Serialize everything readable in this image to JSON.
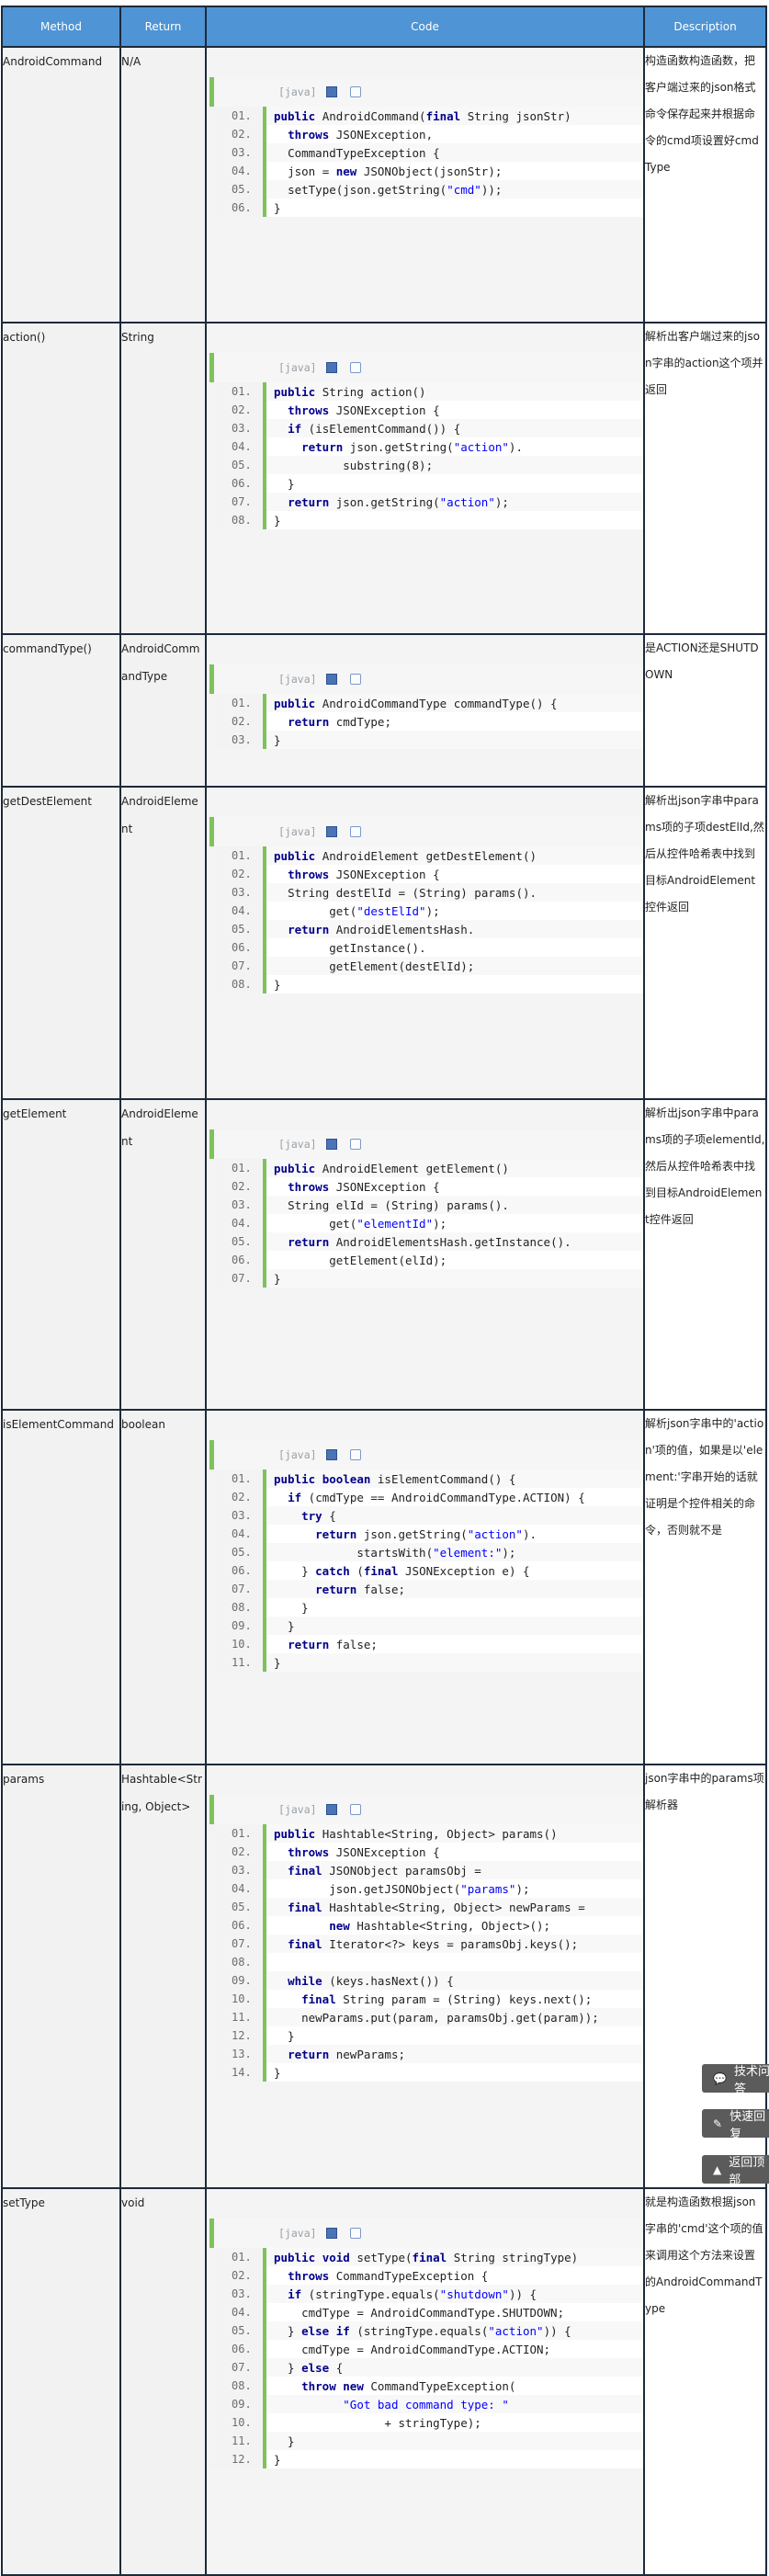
{
  "header": {
    "method": "Method",
    "return": "Return",
    "code": "Code",
    "description": "Description"
  },
  "code_lang_label": "[java]",
  "rows": [
    {
      "method": "AndroidCommand",
      "return": "N/A",
      "desc": "构造函数构造函数，把客户端过来的json格式命令保存起来并根据命令的cmd项设置好cmdType",
      "code": [
        "public AndroidCommand(final String jsonStr)",
        "  throws JSONException,",
        "  CommandTypeException {",
        "  json = new JSONObject(jsonStr);",
        "  setType(json.getString(\"cmd\"));",
        "}"
      ]
    },
    {
      "method": "action()",
      "return": "String",
      "desc": "解析出客户端过来的json字串的action这个项并返回",
      "code": [
        "public String action()",
        "  throws JSONException {",
        "  if (isElementCommand()) {",
        "    return json.getString(\"action\").",
        "          substring(8);",
        "  }",
        "  return json.getString(\"action\");",
        "}"
      ]
    },
    {
      "method": "commandType()",
      "return": "AndroidCommandType",
      "desc": "是ACTION还是SHUTDOWN",
      "code": [
        "public AndroidCommandType commandType() {",
        "  return cmdType;",
        "}"
      ]
    },
    {
      "method": "getDestElement",
      "return": "AndroidElement",
      "desc": "解析出json字串中params项的子项destElId,然后从控件哈希表中找到目标AndroidElement控件返回",
      "code": [
        "public AndroidElement getDestElement()",
        "  throws JSONException {",
        "  String destElId = (String) params().",
        "        get(\"destElId\");",
        "  return AndroidElementsHash.",
        "        getInstance().",
        "        getElement(destElId);",
        "}"
      ]
    },
    {
      "method": "getElement",
      "return": "AndroidElement",
      "desc": "解析出json字串中params项的子项elementId,然后从控件哈希表中找到目标AndroidElement控件返回",
      "code": [
        "public AndroidElement getElement()",
        "  throws JSONException {",
        "  String elId = (String) params().",
        "        get(\"elementId\");",
        "  return AndroidElementsHash.getInstance().",
        "        getElement(elId);",
        "}"
      ]
    },
    {
      "method": "isElementCommand",
      "return": "boolean",
      "desc": "解析json字串中的'action'项的值，如果是以'element:'字串开始的话就证明是个控件相关的命令，否则就不是",
      "code": [
        "public boolean isElementCommand() {",
        "  if (cmdType == AndroidCommandType.ACTION) {",
        "    try {",
        "      return json.getString(\"action\").",
        "            startsWith(\"element:\");",
        "    } catch (final JSONException e) {",
        "      return false;",
        "    }",
        "  }",
        "  return false;",
        "}"
      ]
    },
    {
      "method": "params",
      "return": "Hashtable<String, Object>",
      "desc": "json字串中的params项解析器",
      "code": [
        "public Hashtable<String, Object> params()",
        "  throws JSONException {",
        "  final JSONObject paramsObj =",
        "        json.getJSONObject(\"params\");",
        "  final Hashtable<String, Object> newParams =",
        "        new Hashtable<String, Object>();",
        "  final Iterator<?> keys = paramsObj.keys();",
        "",
        "  while (keys.hasNext()) {",
        "    final String param = (String) keys.next();",
        "    newParams.put(param, paramsObj.get(param));",
        "  }",
        "  return newParams;",
        "}"
      ]
    },
    {
      "method": "setType",
      "return": "void",
      "desc": "就是构造函数根据json字串的'cmd'这个项的值来调用这个方法来设置的AndroidCommandType",
      "code": [
        "public void setType(final String stringType)",
        "  throws CommandTypeException {",
        "  if (stringType.equals(\"shutdown\")) {",
        "    cmdType = AndroidCommandType.SHUTDOWN;",
        "  } else if (stringType.equals(\"action\")) {",
        "    cmdType = AndroidCommandType.ACTION;",
        "  } else {",
        "    throw new CommandTypeException(",
        "          \"Got bad command type: \"",
        "                + stringType);",
        "  }",
        "}"
      ]
    }
  ],
  "floating_buttons": [
    {
      "icon": "comment-icon",
      "glyph": "💬",
      "label": "技术问答"
    },
    {
      "icon": "tag-icon",
      "glyph": "✎",
      "label": "快速回复"
    },
    {
      "icon": "arrow-up-icon",
      "glyph": "▲",
      "label": "返回顶部"
    }
  ]
}
